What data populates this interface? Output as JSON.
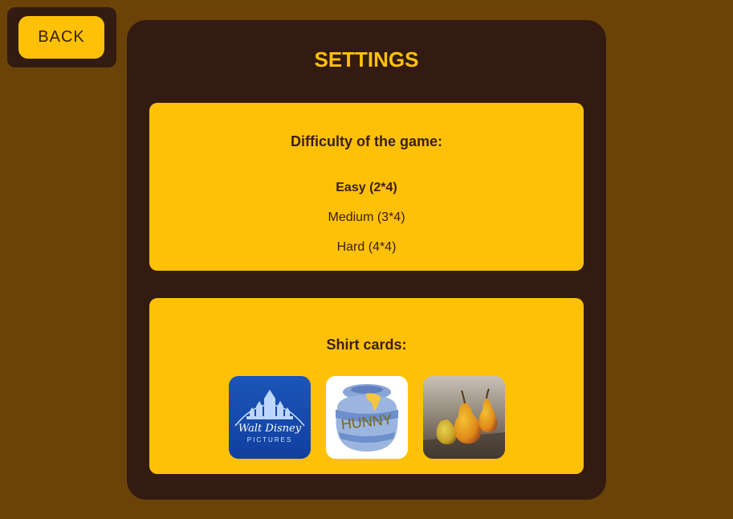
{
  "back_button": {
    "label": "BACK"
  },
  "settings": {
    "title": "SETTINGS",
    "difficulty": {
      "heading": "Difficulty of the game:",
      "options": [
        {
          "label": "Easy (2*4)",
          "selected": true
        },
        {
          "label": "Medium (3*4)",
          "selected": false
        },
        {
          "label": "Hard (4*4)",
          "selected": false
        }
      ]
    },
    "shirts": {
      "heading": "Shirt cards:",
      "items": [
        {
          "icon": "walt-disney-pictures-logo",
          "logo_text": "Walt Disney",
          "logo_subtext": "PICTURES"
        },
        {
          "icon": "hunny-pot-image",
          "logo_text": "HUNNY"
        },
        {
          "icon": "pears-photo"
        }
      ]
    }
  },
  "colors": {
    "background": "#6b4308",
    "panel": "#331b12",
    "accent": "#ffc107",
    "text": "#3a2010"
  }
}
